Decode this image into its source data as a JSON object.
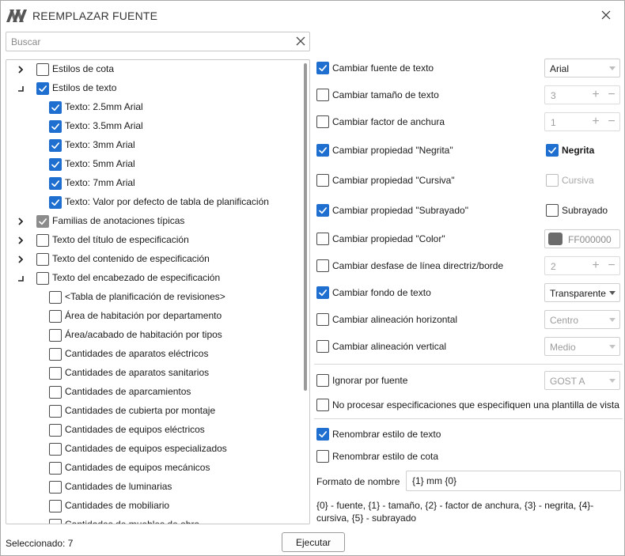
{
  "window": {
    "title": "REEMPLAZAR FUENTE"
  },
  "search": {
    "placeholder": "Buscar",
    "value": ""
  },
  "tree": {
    "items": [
      {
        "label": "Estilos de cota",
        "level": 0,
        "expander": "collapsed",
        "state": "unchecked"
      },
      {
        "label": "Estilos de texto",
        "level": 0,
        "expander": "expanded",
        "state": "checked"
      },
      {
        "label": "Texto: 2.5mm Arial",
        "level": 1,
        "expander": "none",
        "state": "checked"
      },
      {
        "label": "Texto: 3.5mm Arial",
        "level": 1,
        "expander": "none",
        "state": "checked"
      },
      {
        "label": "Texto: 3mm Arial",
        "level": 1,
        "expander": "none",
        "state": "checked"
      },
      {
        "label": "Texto: 5mm  Arial",
        "level": 1,
        "expander": "none",
        "state": "checked"
      },
      {
        "label": "Texto: 7mm  Arial",
        "level": 1,
        "expander": "none",
        "state": "checked"
      },
      {
        "label": "Texto: Valor por defecto de tabla de planificación",
        "level": 1,
        "expander": "none",
        "state": "checked"
      },
      {
        "label": "Familias de anotaciones típicas",
        "level": 0,
        "expander": "collapsed",
        "state": "checked-gray"
      },
      {
        "label": "Texto del título de especificación",
        "level": 0,
        "expander": "collapsed",
        "state": "unchecked"
      },
      {
        "label": "Texto del contenido de especificación",
        "level": 0,
        "expander": "collapsed",
        "state": "unchecked"
      },
      {
        "label": "Texto del encabezado de especificación",
        "level": 0,
        "expander": "expanded",
        "state": "unchecked"
      },
      {
        "label": "<Tabla de planificación de revisiones>",
        "level": 1,
        "expander": "none",
        "state": "unchecked"
      },
      {
        "label": "Área de habitación por departamento",
        "level": 1,
        "expander": "none",
        "state": "unchecked"
      },
      {
        "label": "Área/acabado de habitación por tipos",
        "level": 1,
        "expander": "none",
        "state": "unchecked"
      },
      {
        "label": "Cantidades de aparatos eléctricos",
        "level": 1,
        "expander": "none",
        "state": "unchecked"
      },
      {
        "label": "Cantidades de aparatos sanitarios",
        "level": 1,
        "expander": "none",
        "state": "unchecked"
      },
      {
        "label": "Cantidades de aparcamientos",
        "level": 1,
        "expander": "none",
        "state": "unchecked"
      },
      {
        "label": "Cantidades de cubierta por montaje",
        "level": 1,
        "expander": "none",
        "state": "unchecked"
      },
      {
        "label": "Cantidades de equipos eléctricos",
        "level": 1,
        "expander": "none",
        "state": "unchecked"
      },
      {
        "label": "Cantidades de equipos especializados",
        "level": 1,
        "expander": "none",
        "state": "unchecked"
      },
      {
        "label": "Cantidades de equipos mecánicos",
        "level": 1,
        "expander": "none",
        "state": "unchecked"
      },
      {
        "label": "Cantidades de luminarias",
        "level": 1,
        "expander": "none",
        "state": "unchecked"
      },
      {
        "label": "Cantidades de mobiliario",
        "level": 1,
        "expander": "none",
        "state": "unchecked"
      },
      {
        "label": "Cantidades de muebles de obra",
        "level": 1,
        "expander": "none",
        "state": "unchecked"
      }
    ]
  },
  "options": {
    "font": {
      "label": "Cambiar fuente de texto",
      "checked": true,
      "value": "Arial"
    },
    "size": {
      "label": "Cambiar tamaño de texto",
      "checked": false,
      "value": "3"
    },
    "width": {
      "label": "Cambiar factor de anchura",
      "checked": false,
      "value": "1"
    },
    "bold": {
      "label": "Cambiar propiedad \"Negrita\"",
      "checked": true,
      "side_label": "Negrita",
      "side_checked": true
    },
    "italic": {
      "label": "Cambiar propiedad \"Cursiva\"",
      "checked": false,
      "side_label": "Cursiva",
      "side_checked": false
    },
    "underline": {
      "label": "Cambiar propiedad \"Subrayado\"",
      "checked": true,
      "side_label": "Subrayado",
      "side_checked": false
    },
    "color": {
      "label": "Cambiar propiedad \"Color\"",
      "checked": false,
      "value": "FF000000",
      "swatch": "#6b6b6b"
    },
    "offset": {
      "label": "Cambiar desfase de línea directriz/borde",
      "checked": false,
      "value": "2"
    },
    "background": {
      "label": "Cambiar fondo de texto",
      "checked": true,
      "value": "Transparente"
    },
    "halign": {
      "label": "Cambiar alineación horizontal",
      "checked": false,
      "value": "Centro"
    },
    "valign": {
      "label": "Cambiar alineación vertical",
      "checked": false,
      "value": "Medio"
    },
    "ignore": {
      "label": "Ignorar por fuente",
      "checked": false,
      "value": "GOST A"
    },
    "skip_templates": {
      "label": "No procesar especificaciones que especifiquen una plantilla de vista",
      "checked": false
    },
    "rename_text": {
      "label": "Renombrar estilo de texto",
      "checked": true
    },
    "rename_dim": {
      "label": "Renombrar estilo de cota",
      "checked": false
    }
  },
  "format": {
    "label": "Formato de nombre",
    "value": "{1} mm {0}",
    "hint": "{0} - fuente, {1} - tamaño, {2} - factor de anchura, {3} - negrita, {4}- cursiva, {5} - subrayado"
  },
  "footer": {
    "status": "Seleccionado: 7",
    "execute_label": "Ejecutar"
  },
  "colors": {
    "accent": "#1f6fd1",
    "partial": "#8c8c8c",
    "border": "#c8c8c8"
  }
}
